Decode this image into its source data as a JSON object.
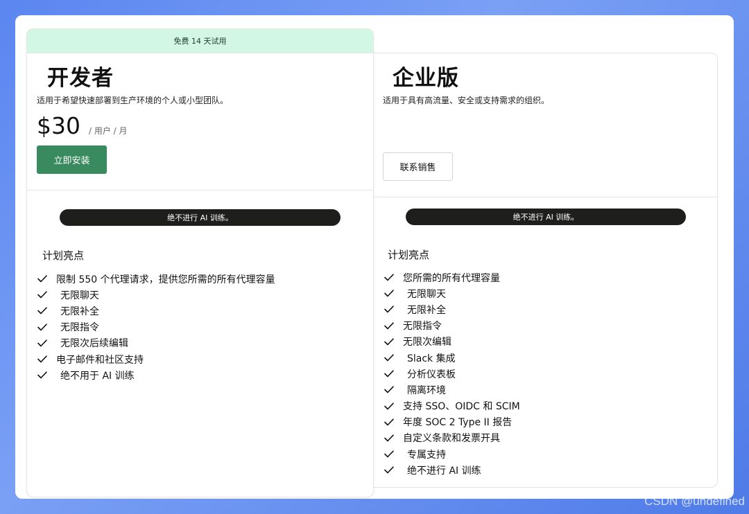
{
  "developer": {
    "trial_banner": "免费 14 天试用",
    "title": "开发者",
    "description": "适用于希望快速部署到生产环境的个人或小型团队。",
    "price": "$30",
    "price_unit": "/ 用户 / 月",
    "cta_label": "立即安装",
    "ai_badge": "绝不进行 AI 训练。",
    "highlights_title": "计划亮点",
    "features": [
      {
        "text": "限制 550 个代理请求，提供您所需的所有代理容量",
        "indent": false
      },
      {
        "text": "无限聊天",
        "indent": true
      },
      {
        "text": "无限补全",
        "indent": true
      },
      {
        "text": "无限指令",
        "indent": true
      },
      {
        "text": "无限次后续编辑",
        "indent": true
      },
      {
        "text": "电子邮件和社区支持",
        "indent": false
      },
      {
        "text": "绝不用于 AI 训练",
        "indent": true
      }
    ]
  },
  "enterprise": {
    "title": "企业版",
    "description": "适用于具有高流量、安全或支持需求的组织。",
    "cta_label": "联系销售",
    "ai_badge": "绝不进行 AI 训练。",
    "highlights_title": "计划亮点",
    "features": [
      {
        "text": "您所需的所有代理容量",
        "indent": false
      },
      {
        "text": "无限聊天",
        "indent": true
      },
      {
        "text": "无限补全",
        "indent": true
      },
      {
        "text": "无限指令",
        "indent": false
      },
      {
        "text": "无限次编辑",
        "indent": false
      },
      {
        "text": "Slack 集成",
        "indent": true
      },
      {
        "text": "分析仪表板",
        "indent": true
      },
      {
        "text": "隔离环境",
        "indent": true
      },
      {
        "text": "支持 SSO、OIDC 和 SCIM",
        "indent": false
      },
      {
        "text": "年度 SOC 2 Type II 报告",
        "indent": false
      },
      {
        "text": "自定义条款和发票开具",
        "indent": false
      },
      {
        "text": "专属支持",
        "indent": true
      },
      {
        "text": "绝不进行 AI 训练",
        "indent": true
      }
    ]
  },
  "watermark": "CSDN @undefined",
  "icons": {
    "feature_check": "check-icon"
  },
  "colors": {
    "primary_button": "#3a8a5f",
    "trial_banner_bg": "#d2f7e4",
    "badge_bg": "#1e1e1c",
    "background_blue": "#5b86f0"
  }
}
